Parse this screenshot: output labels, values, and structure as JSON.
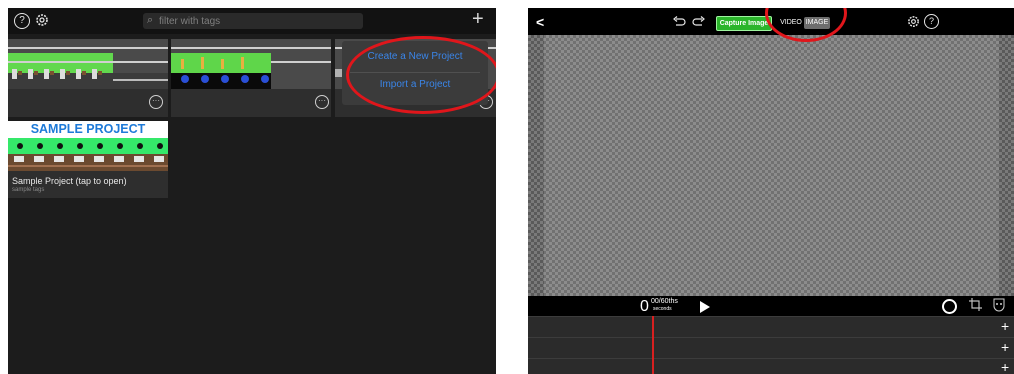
{
  "left": {
    "search": {
      "placeholder": "filter with tags"
    },
    "icons": {
      "help": "?",
      "settings": "gear-icon",
      "add": "+",
      "more": "···"
    },
    "menu": {
      "create": "Create a New Project",
      "import": "Import a Project"
    },
    "sample": {
      "banner": "SAMPLE PROJECT",
      "title": "Sample Project (tap to open)",
      "tags": "sample tags"
    }
  },
  "right": {
    "toolbar": {
      "back": "<",
      "capture": "Capture Image",
      "video": "VIDEO",
      "image": "IMAGE",
      "help": "?"
    },
    "timeline": {
      "big": "0",
      "fraction": "00/60ths",
      "unit": "seconds",
      "add": "+"
    }
  },
  "colors": {
    "accent_green": "#2bb52b",
    "menu_blue": "#3a85e8",
    "annotation_red": "#e0161b",
    "playhead": "#d82020"
  }
}
